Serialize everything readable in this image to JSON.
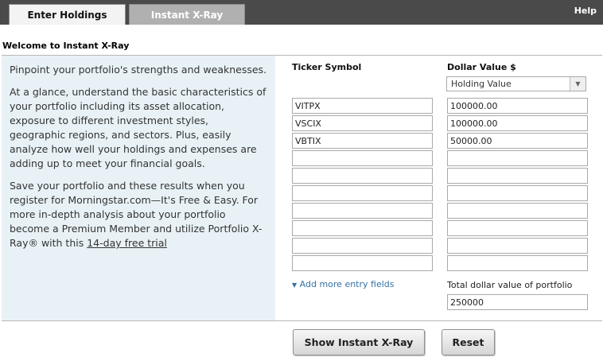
{
  "tabs": [
    {
      "label": "Enter Holdings",
      "active": true
    },
    {
      "label": "Instant X-Ray",
      "active": false
    }
  ],
  "help_label": "Help",
  "welcome_title": "Welcome to Instant X-Ray",
  "intro": {
    "p1": "Pinpoint your portfolio's strengths and weaknesses.",
    "p2": "At a glance, understand the basic characteristics of your portfolio including its asset allocation, exposure to different investment styles, geographic regions, and sectors. Plus, easily analyze how well your holdings and expenses are adding up to meet your financial goals.",
    "p3": "Save your portfolio and these results when you register for Morningstar.com—It's Free & Easy. For more in-depth analysis about your portfolio become a Premium Member and utilize Portfolio X-Ray® with this",
    "trial_link": "14-day free trial"
  },
  "columns": {
    "ticker_header": "Ticker Symbol",
    "dollar_header": "Dollar Value $",
    "value_type_selected": "Holding Value"
  },
  "holdings": [
    {
      "ticker": "VITPX",
      "value": "100000.00"
    },
    {
      "ticker": "VSCIX",
      "value": "100000.00"
    },
    {
      "ticker": "VBTIX",
      "value": "50000.00"
    },
    {
      "ticker": "",
      "value": ""
    },
    {
      "ticker": "",
      "value": ""
    },
    {
      "ticker": "",
      "value": ""
    },
    {
      "ticker": "",
      "value": ""
    },
    {
      "ticker": "",
      "value": ""
    },
    {
      "ticker": "",
      "value": ""
    },
    {
      "ticker": "",
      "value": ""
    }
  ],
  "add_more_label": "Add more entry fields",
  "total_label": "Total dollar value of portfolio",
  "total_value": "250000",
  "buttons": {
    "show": "Show Instant X-Ray",
    "reset": "Reset"
  },
  "colors": {
    "topbar": "#4a4a4a",
    "left_panel": "#e8f2f6",
    "link": "#3472a6"
  }
}
